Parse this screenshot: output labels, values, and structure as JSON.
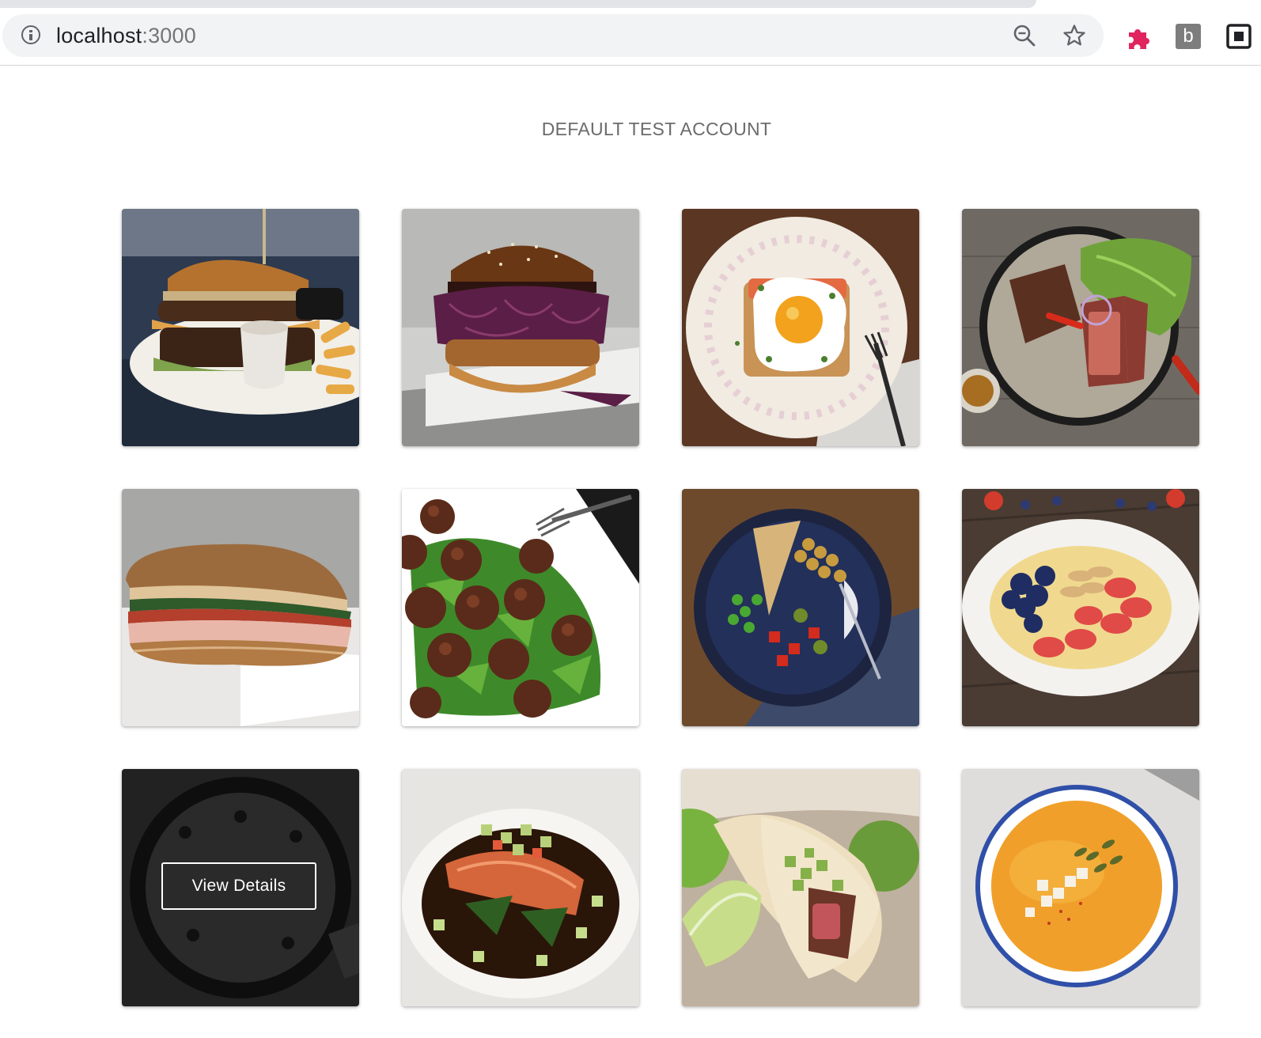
{
  "browser": {
    "url_host": "localhost",
    "url_port": ":3000",
    "extension_b_label": "b",
    "accent_puzzle": "#e0245e"
  },
  "page": {
    "title": "DEFAULT TEST ACCOUNT"
  },
  "recipes": [
    {
      "name": "recipe-card-burger-fries",
      "image": "burger-with-fries-and-dip"
    },
    {
      "name": "recipe-card-slaw-burger",
      "image": "burger-with-purple-slaw"
    },
    {
      "name": "recipe-card-egg-toast",
      "image": "fried-egg-toast-on-floral-plate"
    },
    {
      "name": "recipe-card-steak-salad",
      "image": "sliced-steak-with-lettuce-bowl"
    },
    {
      "name": "recipe-card-sandwich",
      "image": "deli-sandwich"
    },
    {
      "name": "recipe-card-meatballs",
      "image": "meatballs-on-arugula"
    },
    {
      "name": "recipe-card-veggie-bowl",
      "image": "chickpea-veggie-bowl"
    },
    {
      "name": "recipe-card-porridge",
      "image": "porridge-with-berries"
    },
    {
      "name": "recipe-card-skillet",
      "image": "skillet-pie",
      "hovered": true
    },
    {
      "name": "recipe-card-salmon",
      "image": "salmon-with-vegetables"
    },
    {
      "name": "recipe-card-tacos",
      "image": "steak-tacos-with-lime"
    },
    {
      "name": "recipe-card-soup",
      "image": "pumpkin-soup"
    }
  ],
  "hover_button": {
    "label": "View Details"
  }
}
